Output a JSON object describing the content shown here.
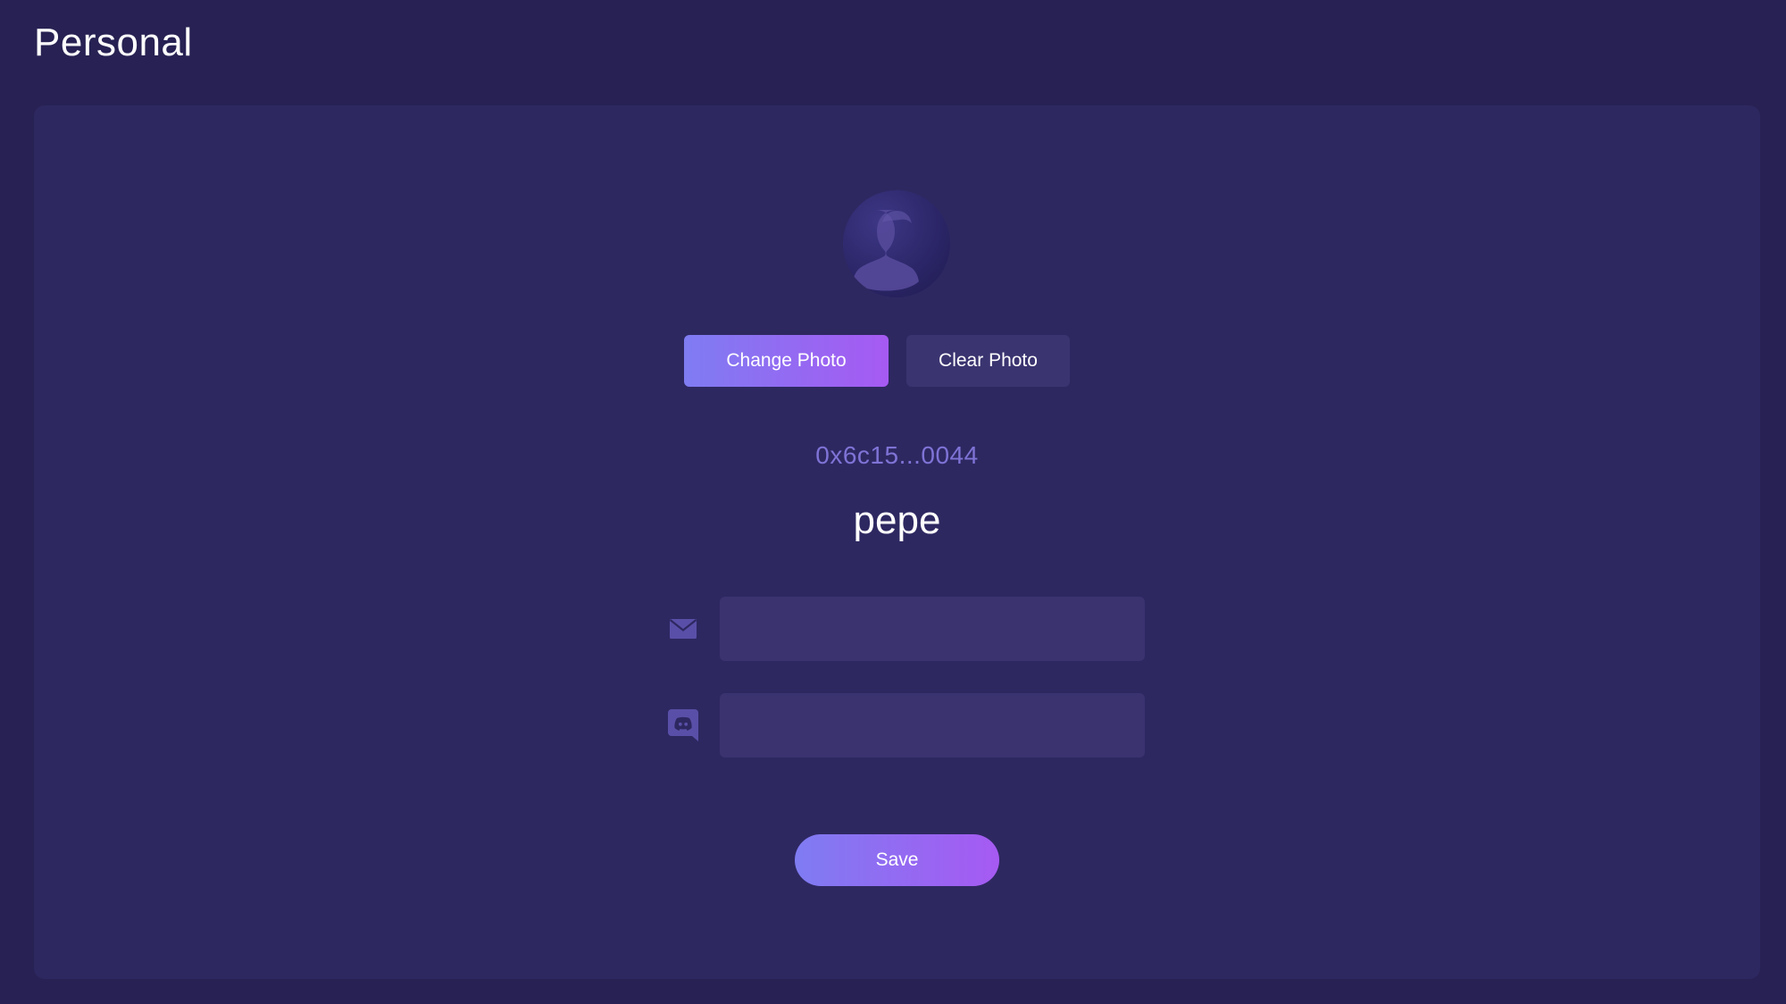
{
  "page": {
    "title": "Personal"
  },
  "profile": {
    "avatar_icon": "user-silhouette-icon",
    "change_photo_label": "Change Photo",
    "clear_photo_label": "Clear Photo",
    "wallet_address": "0x6c15...0044",
    "username": "pepe"
  },
  "fields": {
    "email": {
      "icon": "mail-icon",
      "value": "",
      "placeholder": ""
    },
    "discord": {
      "icon": "discord-icon",
      "value": "",
      "placeholder": ""
    }
  },
  "actions": {
    "save_label": "Save"
  },
  "colors": {
    "background": "#272253",
    "card": "#2e2861",
    "accent_start": "#7f7cf2",
    "accent_end": "#a65af2",
    "address": "#7f73d6",
    "input": "#3a3370",
    "icon": "#5a4fa8"
  }
}
